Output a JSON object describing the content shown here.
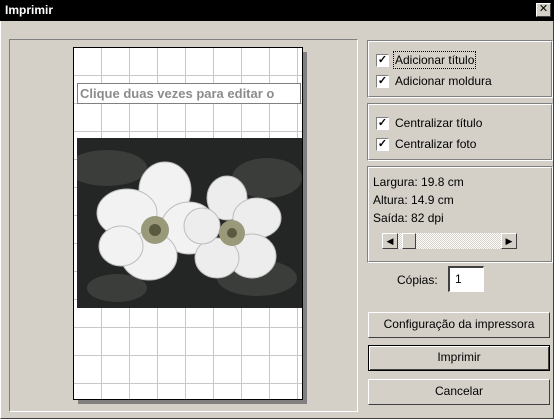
{
  "window": {
    "title": "Imprimir",
    "close_glyph": "✕"
  },
  "preview": {
    "title_placeholder": "Clique duas vezes para editar o",
    "photo_description_icon": "flower-photo"
  },
  "options_group1": {
    "add_title": {
      "label": "Adicionar título",
      "checked": true
    },
    "add_frame": {
      "label": "Adicionar moldura",
      "checked": true
    }
  },
  "options_group2": {
    "center_title": {
      "label": "Centralizar título",
      "checked": true
    },
    "center_photo": {
      "label": "Centralizar foto",
      "checked": true
    }
  },
  "size_info": {
    "width": "Largura: 19.8 cm",
    "height": "Altura: 14.9 cm",
    "output": "Saída: 82 dpi",
    "slider_position": 0.05
  },
  "copies": {
    "label": "Cópias:",
    "value": "1"
  },
  "buttons": {
    "printer_setup": "Configuração da impressora",
    "print": "Imprimir",
    "cancel": "Cancelar"
  },
  "check_glyph": "✓",
  "arrow_left": "◀",
  "arrow_right": "▶"
}
